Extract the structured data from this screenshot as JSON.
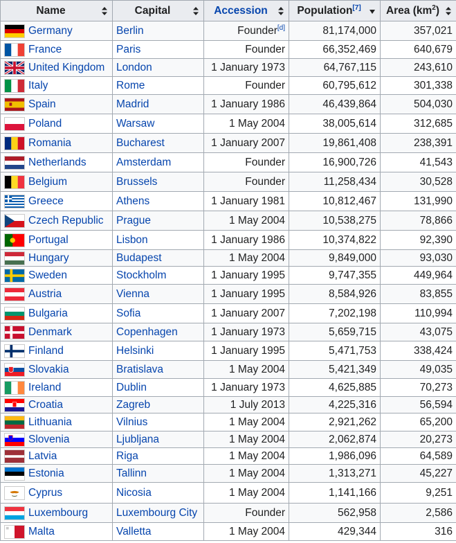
{
  "headers": {
    "name": "Name",
    "capital": "Capital",
    "accession": "Accession",
    "population": "Population",
    "population_ref": "[7]",
    "area": "Area (km",
    "area_sup": "2",
    "area_close": ")"
  },
  "founder_ref": "[d]",
  "rows": [
    {
      "name": "Germany",
      "capital": "Berlin",
      "accession": "Founder",
      "population": "81,174,000",
      "area": "357,021",
      "flag": "de",
      "ref": true
    },
    {
      "name": "France",
      "capital": "Paris",
      "accession": "Founder",
      "population": "66,352,469",
      "area": "640,679",
      "flag": "fr"
    },
    {
      "name": "United Kingdom",
      "capital": "London",
      "accession": "1 January 1973",
      "population": "64,767,115",
      "area": "243,610",
      "flag": "gb"
    },
    {
      "name": "Italy",
      "capital": "Rome",
      "accession": "Founder",
      "population": "60,795,612",
      "area": "301,338",
      "flag": "it"
    },
    {
      "name": "Spain",
      "capital": "Madrid",
      "accession": "1 January 1986",
      "population": "46,439,864",
      "area": "504,030",
      "flag": "es"
    },
    {
      "name": "Poland",
      "capital": "Warsaw",
      "accession": "1 May 2004",
      "population": "38,005,614",
      "area": "312,685",
      "flag": "pl"
    },
    {
      "name": "Romania",
      "capital": "Bucharest",
      "accession": "1 January 2007",
      "population": "19,861,408",
      "area": "238,391",
      "flag": "ro"
    },
    {
      "name": "Netherlands",
      "capital": "Amsterdam",
      "accession": "Founder",
      "population": "16,900,726",
      "area": "41,543",
      "flag": "nl"
    },
    {
      "name": "Belgium",
      "capital": "Brussels",
      "accession": "Founder",
      "population": "11,258,434",
      "area": "30,528",
      "flag": "be"
    },
    {
      "name": "Greece",
      "capital": "Athens",
      "accession": "1 January 1981",
      "population": "10,812,467",
      "area": "131,990",
      "flag": "gr"
    },
    {
      "name": "Czech Republic",
      "capital": "Prague",
      "accession": "1 May 2004",
      "population": "10,538,275",
      "area": "78,866",
      "flag": "cz"
    },
    {
      "name": "Portugal",
      "capital": "Lisbon",
      "accession": "1 January 1986",
      "population": "10,374,822",
      "area": "92,390",
      "flag": "pt"
    },
    {
      "name": "Hungary",
      "capital": "Budapest",
      "accession": "1 May 2004",
      "population": "9,849,000",
      "area": "93,030",
      "flag": "hu"
    },
    {
      "name": "Sweden",
      "capital": "Stockholm",
      "accession": "1 January 1995",
      "population": "9,747,355",
      "area": "449,964",
      "flag": "se"
    },
    {
      "name": "Austria",
      "capital": "Vienna",
      "accession": "1 January 1995",
      "population": "8,584,926",
      "area": "83,855",
      "flag": "at"
    },
    {
      "name": "Bulgaria",
      "capital": "Sofia",
      "accession": "1 January 2007",
      "population": "7,202,198",
      "area": "110,994",
      "flag": "bg"
    },
    {
      "name": "Denmark",
      "capital": "Copenhagen",
      "accession": "1 January 1973",
      "population": "5,659,715",
      "area": "43,075",
      "flag": "dk"
    },
    {
      "name": "Finland",
      "capital": "Helsinki",
      "accession": "1 January 1995",
      "population": "5,471,753",
      "area": "338,424",
      "flag": "fi"
    },
    {
      "name": "Slovakia",
      "capital": "Bratislava",
      "accession": "1 May 2004",
      "population": "5,421,349",
      "area": "49,035",
      "flag": "sk"
    },
    {
      "name": "Ireland",
      "capital": "Dublin",
      "accession": "1 January 1973",
      "population": "4,625,885",
      "area": "70,273",
      "flag": "ie"
    },
    {
      "name": "Croatia",
      "capital": "Zagreb",
      "accession": "1 July 2013",
      "population": "4,225,316",
      "area": "56,594",
      "flag": "hr"
    },
    {
      "name": "Lithuania",
      "capital": "Vilnius",
      "accession": "1 May 2004",
      "population": "2,921,262",
      "area": "65,200",
      "flag": "lt"
    },
    {
      "name": "Slovenia",
      "capital": "Ljubljana",
      "accession": "1 May 2004",
      "population": "2,062,874",
      "area": "20,273",
      "flag": "si"
    },
    {
      "name": "Latvia",
      "capital": "Riga",
      "accession": "1 May 2004",
      "population": "1,986,096",
      "area": "64,589",
      "flag": "lv"
    },
    {
      "name": "Estonia",
      "capital": "Tallinn",
      "accession": "1 May 2004",
      "population": "1,313,271",
      "area": "45,227",
      "flag": "ee"
    },
    {
      "name": "Cyprus",
      "capital": "Nicosia",
      "accession": "1 May 2004",
      "population": "1,141,166",
      "area": "9,251",
      "flag": "cy"
    },
    {
      "name": "Luxembourg",
      "capital": "Luxembourg City",
      "accession": "Founder",
      "population": "562,958",
      "area": "2,586",
      "flag": "lu"
    },
    {
      "name": "Malta",
      "capital": "Valletta",
      "accession": "1 May 2004",
      "population": "429,344",
      "area": "316",
      "flag": "mt"
    }
  ]
}
